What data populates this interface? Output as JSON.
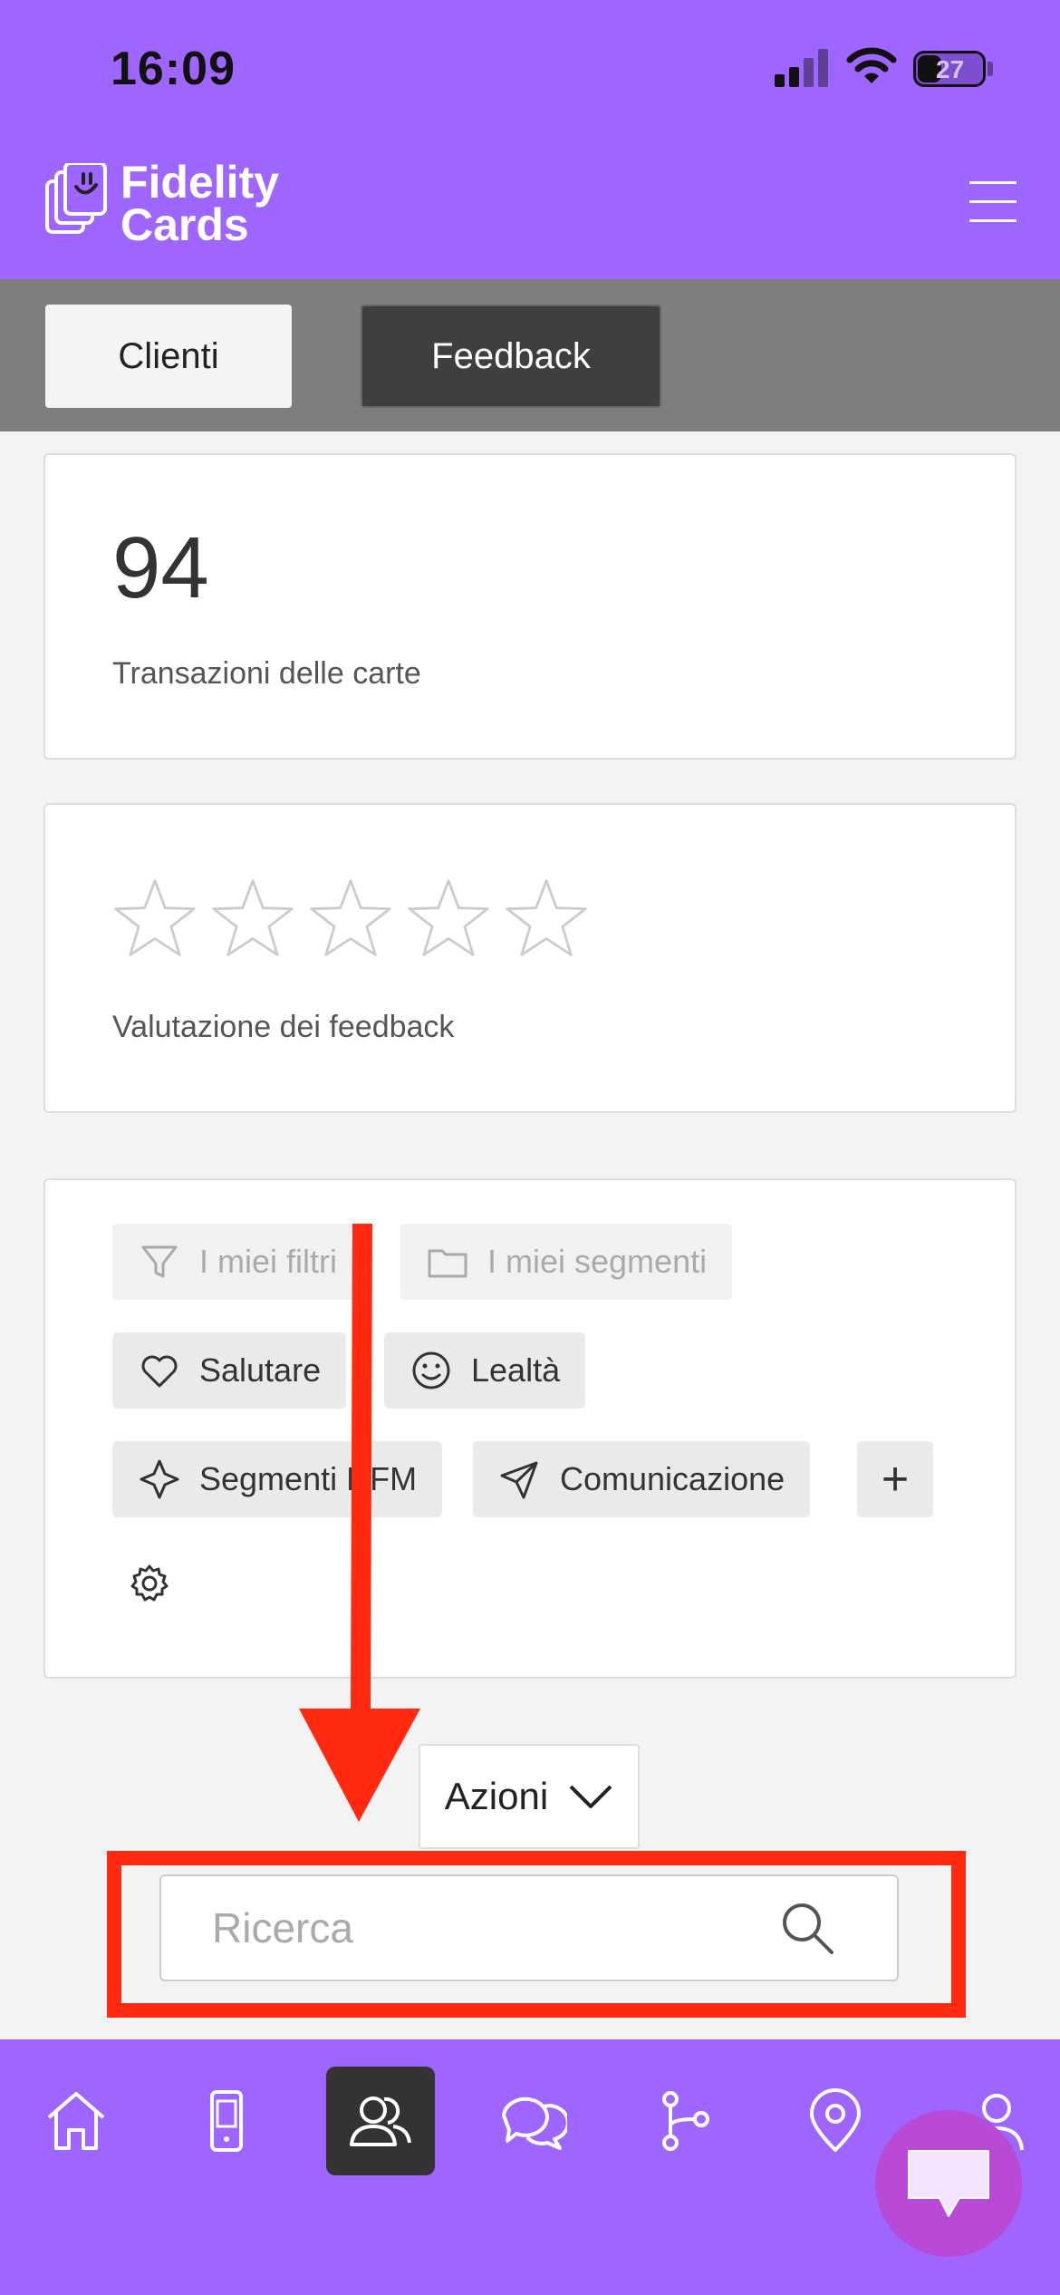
{
  "status_bar": {
    "time": "16:09",
    "battery": "27"
  },
  "header": {
    "logo_line1": "Fidelity",
    "logo_line2": "Cards"
  },
  "tabs": [
    {
      "label": "Clienti",
      "active": false
    },
    {
      "label": "Feedback",
      "active": true
    }
  ],
  "stats": {
    "transactions_value": "94",
    "transactions_label": "Transazioni delle carte",
    "rating_label": "Valutazione dei feedback",
    "rating_stars": 0,
    "rating_max": 5
  },
  "filters": {
    "my_filters": "I miei filtri",
    "my_segments": "I miei segmenti",
    "greet": "Salutare",
    "loyalty": "Lealtà",
    "rfm_segments": "Segmenti RFM",
    "communication": "Comunicazione",
    "add": "+"
  },
  "actions": {
    "label": "Azioni"
  },
  "search": {
    "placeholder": "Ricerca"
  },
  "bottom_nav": [
    {
      "icon": "home-icon"
    },
    {
      "icon": "phone-card-icon"
    },
    {
      "icon": "customers-icon",
      "active": true
    },
    {
      "icon": "chat-icon"
    },
    {
      "icon": "flow-icon"
    },
    {
      "icon": "location-icon"
    },
    {
      "icon": "profile-icon"
    }
  ],
  "colors": {
    "brand": "#9f66ff",
    "highlight": "#ff2a10",
    "fab": "#b94ad6"
  }
}
